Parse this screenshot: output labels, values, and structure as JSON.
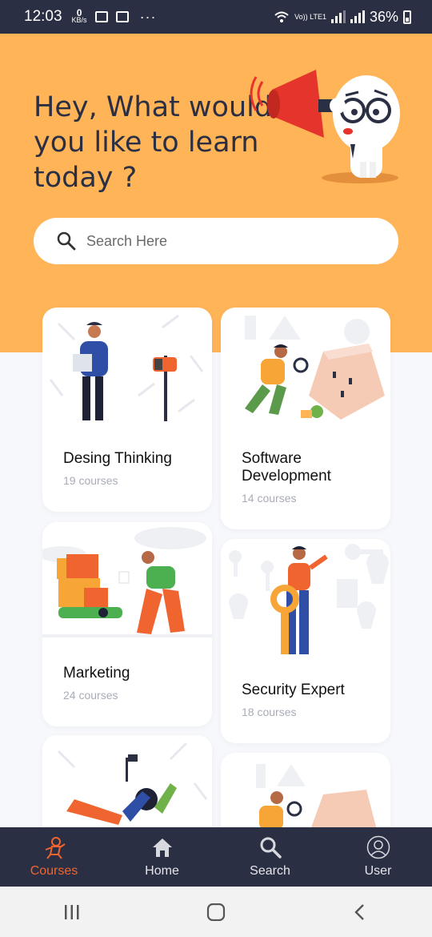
{
  "status_bar": {
    "time": "12:03",
    "data_rate_value": "0",
    "data_rate_unit": "KB/s",
    "dots": "···",
    "network": "Vo)) LTE1",
    "battery": "36%"
  },
  "header": {
    "greeting": "Hey, What would you like to learn today ?"
  },
  "search": {
    "placeholder": "Search Here",
    "icon": "search-icon"
  },
  "courses": [
    {
      "title": "Desing Thinking",
      "count": "19 courses"
    },
    {
      "title": "Software Development",
      "count": "14 courses"
    },
    {
      "title": "Marketing",
      "count": "24 courses"
    },
    {
      "title": "Security Expert",
      "count": "18 courses"
    }
  ],
  "tabbar": {
    "tabs": [
      {
        "label": "Courses",
        "icon": "courses-icon",
        "active": true
      },
      {
        "label": "Home",
        "icon": "home-icon",
        "active": false
      },
      {
        "label": "Search",
        "icon": "search-icon",
        "active": false
      },
      {
        "label": "User",
        "icon": "user-icon",
        "active": false
      }
    ]
  },
  "colors": {
    "hero": "#ffb457",
    "navy": "#2b2f44",
    "accent": "#f0652f",
    "background": "#f7f8fc"
  }
}
